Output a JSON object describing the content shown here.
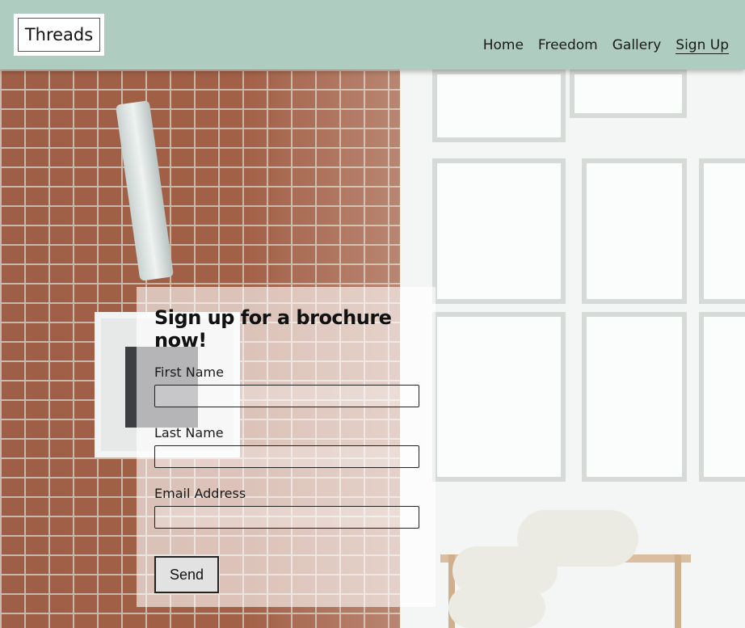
{
  "header": {
    "logo_text": "Threads",
    "bg_color": "#aecdc0",
    "nav": [
      {
        "label": "Home"
      },
      {
        "label": "Freedom"
      },
      {
        "label": "Gallery"
      },
      {
        "label": "Sign Up",
        "active": true
      }
    ]
  },
  "form": {
    "title": "Sign up for a brochure now!",
    "fields": [
      {
        "label": "First Name",
        "value": ""
      },
      {
        "label": "Last Name",
        "value": ""
      },
      {
        "label": "Email Address",
        "value": ""
      }
    ],
    "submit_label": "Send"
  }
}
